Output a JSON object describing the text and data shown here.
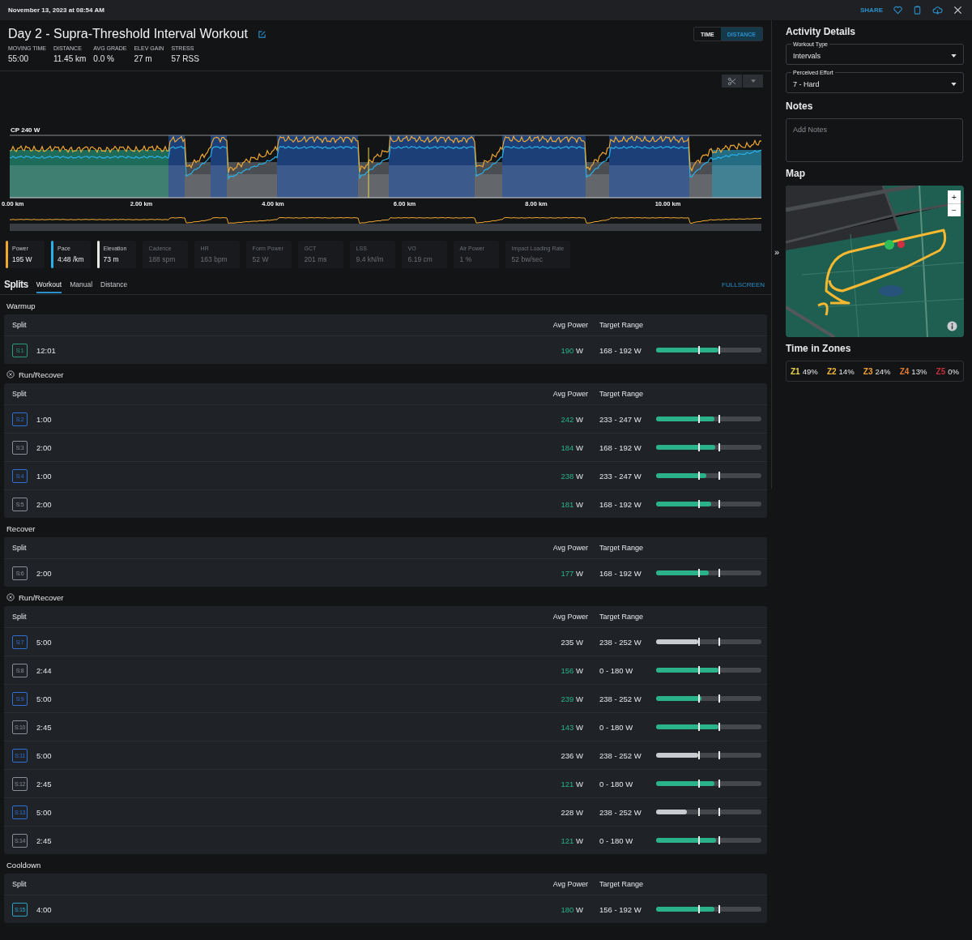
{
  "top_bar": {
    "date": "November 13, 2023 at 08:54 AM",
    "share": "SHARE"
  },
  "title": "Day 2 - Supra-Threshold Interval Workout",
  "stats": [
    {
      "label": "MOVING TIME",
      "value": "55:00"
    },
    {
      "label": "DISTANCE",
      "value": "11.45 km"
    },
    {
      "label": "AVG GRADE",
      "value": "0.0 %"
    },
    {
      "label": "ELEV GAIN",
      "value": "27 m"
    },
    {
      "label": "STRESS",
      "value": "57 RSS"
    }
  ],
  "view_toggle": [
    {
      "label": "TIME",
      "selected": false
    },
    {
      "label": "DISTANCE",
      "selected": true
    }
  ],
  "chart": {
    "cp_label": "CP 240 W",
    "x_ticks": [
      "0.00 km",
      "2.00 km",
      "4.00 km",
      "6.00 km",
      "8.00 km",
      "10.00 km"
    ]
  },
  "metrics": [
    {
      "label": "Power",
      "value": "195 W",
      "selected": true,
      "color": "#f0a830"
    },
    {
      "label": "Pace",
      "value": "4:48 /km",
      "selected": true,
      "color": "#2ab0e8"
    },
    {
      "label": "Elevation",
      "value": "73 m",
      "selected": true,
      "color": "#e8e8e8"
    },
    {
      "label": "Cadence",
      "value": "188 spm",
      "selected": false
    },
    {
      "label": "HR",
      "value": "163 bpm",
      "selected": false
    },
    {
      "label": "Form Power",
      "value": "52 W",
      "selected": false
    },
    {
      "label": "GCT",
      "value": "201 ms",
      "selected": false
    },
    {
      "label": "LSS",
      "value": "9.4 kN/m",
      "selected": false
    },
    {
      "label": "VO",
      "value": "6.19 cm",
      "selected": false
    },
    {
      "label": "Air Power",
      "value": "1 %",
      "selected": false
    },
    {
      "label": "Impact Loading Rate",
      "value": "52 bw/sec",
      "selected": false
    }
  ],
  "splits": {
    "title": "Splits",
    "tabs": [
      {
        "label": "Workout",
        "selected": true
      },
      {
        "label": "Manual",
        "selected": false
      },
      {
        "label": "Distance",
        "selected": false
      }
    ],
    "fullscreen": "FULLSCREEN",
    "groups": [
      {
        "title": "Warmup",
        "collapsible": false,
        "columns": [
          "Split",
          "Avg Power",
          "Target Range"
        ],
        "rows": [
          {
            "split": "S:1",
            "color": "#2a9d78",
            "duration": "12:01",
            "power": "190",
            "unit": "W",
            "range": "168 - 192 W",
            "in_range": true,
            "level": 0.59
          }
        ]
      },
      {
        "title": "Run/Recover",
        "collapsible": true,
        "columns": [
          "Split",
          "Avg Power",
          "Target Range"
        ],
        "rows": [
          {
            "split": "S:2",
            "color": "#2f6fd6",
            "duration": "1:00",
            "power": "242",
            "unit": "W",
            "range": "233 - 247 W",
            "in_range": true,
            "level": 0.55
          },
          {
            "split": "S:3",
            "color": "#8a8f96",
            "duration": "2:00",
            "power": "184",
            "unit": "W",
            "range": "168 - 192 W",
            "in_range": true,
            "level": 0.56
          },
          {
            "split": "S:4",
            "color": "#2f6fd6",
            "duration": "1:00",
            "power": "238",
            "unit": "W",
            "range": "233 - 247 W",
            "in_range": true,
            "level": 0.48
          },
          {
            "split": "S:5",
            "color": "#8a8f96",
            "duration": "2:00",
            "power": "181",
            "unit": "W",
            "range": "168 - 192 W",
            "in_range": true,
            "level": 0.52
          }
        ]
      },
      {
        "title": "Recover",
        "collapsible": false,
        "columns": [
          "Split",
          "Avg Power",
          "Target Range"
        ],
        "rows": [
          {
            "split": "S:6",
            "color": "#8a8f96",
            "duration": "2:00",
            "power": "177",
            "unit": "W",
            "range": "168 - 192 W",
            "in_range": true,
            "level": 0.5
          }
        ]
      },
      {
        "title": "Run/Recover",
        "collapsible": true,
        "columns": [
          "Split",
          "Avg Power",
          "Target Range"
        ],
        "rows": [
          {
            "split": "S:7",
            "color": "#2f6fd6",
            "duration": "5:00",
            "power": "235",
            "unit": "W",
            "range": "238 - 252 W",
            "in_range": false,
            "level": 0.4
          },
          {
            "split": "S:8",
            "color": "#8a8f96",
            "duration": "2:44",
            "power": "156",
            "unit": "W",
            "range": "0 - 180 W",
            "in_range": true,
            "level": 0.59
          },
          {
            "split": "S:9",
            "color": "#2f6fd6",
            "duration": "5:00",
            "power": "239",
            "unit": "W",
            "range": "238 - 252 W",
            "in_range": true,
            "level": 0.43
          },
          {
            "split": "S:10",
            "color": "#8a8f96",
            "duration": "2:45",
            "power": "143",
            "unit": "W",
            "range": "0 - 180 W",
            "in_range": true,
            "level": 0.59
          },
          {
            "split": "S:11",
            "color": "#2f6fd6",
            "duration": "5:00",
            "power": "236",
            "unit": "W",
            "range": "238 - 252 W",
            "in_range": false,
            "level": 0.4
          },
          {
            "split": "S:12",
            "color": "#8a8f96",
            "duration": "2:45",
            "power": "121",
            "unit": "W",
            "range": "0 - 180 W",
            "in_range": true,
            "level": 0.55
          },
          {
            "split": "S:13",
            "color": "#2f6fd6",
            "duration": "5:00",
            "power": "228",
            "unit": "W",
            "range": "238 - 252 W",
            "in_range": false,
            "level": 0.29
          },
          {
            "split": "S:14",
            "color": "#8a8f96",
            "duration": "2:45",
            "power": "121",
            "unit": "W",
            "range": "0 - 180 W",
            "in_range": true,
            "level": 0.57
          }
        ]
      },
      {
        "title": "Cooldown",
        "collapsible": false,
        "columns": [
          "Split",
          "Avg Power",
          "Target Range"
        ],
        "rows": [
          {
            "split": "S:15",
            "color": "#2ba3c7",
            "duration": "4:00",
            "power": "180",
            "unit": "W",
            "range": "156 - 192 W",
            "in_range": true,
            "level": 0.55
          }
        ]
      }
    ]
  },
  "details": {
    "title": "Activity Details",
    "fields": [
      {
        "label": "Workout Type",
        "value": "Intervals"
      },
      {
        "label": "Perceived Effort",
        "value": "7 - Hard"
      }
    ],
    "notes_title": "Notes",
    "notes_placeholder": "Add Notes",
    "map_title": "Map",
    "collapse_handle": "»",
    "zoom_in": "+",
    "zoom_out": "−",
    "zones_title": "Time in Zones",
    "zones": [
      {
        "label": "Z1",
        "value": "49%",
        "color": "#e8d44d"
      },
      {
        "label": "Z2",
        "value": "14%",
        "color": "#f0b73a"
      },
      {
        "label": "Z3",
        "value": "24%",
        "color": "#f0a030"
      },
      {
        "label": "Z4",
        "value": "13%",
        "color": "#e07b35"
      },
      {
        "label": "Z5",
        "value": "0%",
        "color": "#c0303a"
      }
    ]
  }
}
